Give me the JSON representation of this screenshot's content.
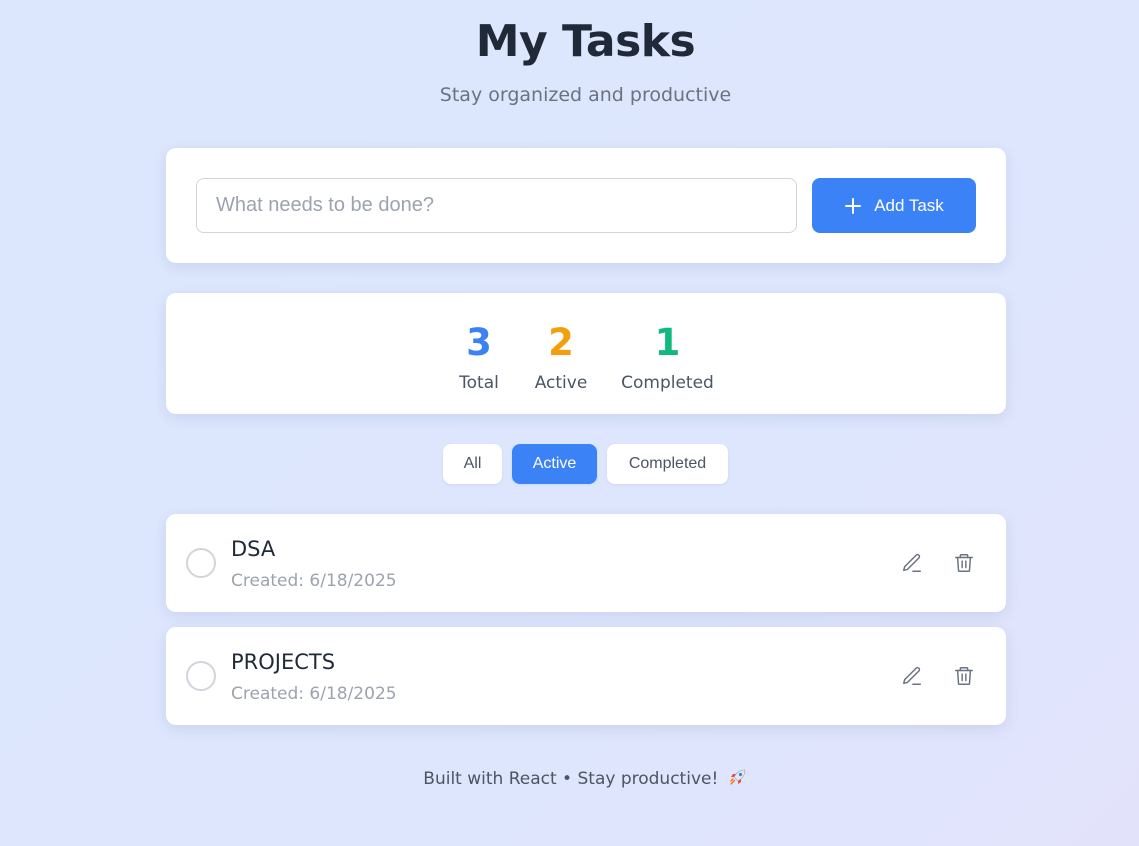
{
  "header": {
    "title": "My Tasks",
    "subtitle": "Stay organized and productive"
  },
  "input": {
    "placeholder": "What needs to be done?",
    "value": "",
    "add_label": "Add Task",
    "add_icon": "plus-icon"
  },
  "stats": {
    "total": {
      "value": "3",
      "label": "Total",
      "color": "#3b82f6"
    },
    "active": {
      "value": "2",
      "label": "Active",
      "color": "#f59e0b"
    },
    "completed": {
      "value": "1",
      "label": "Completed",
      "color": "#10b981"
    }
  },
  "filters": [
    {
      "label": "All",
      "selected": false
    },
    {
      "label": "Active",
      "selected": true
    },
    {
      "label": "Completed",
      "selected": false
    }
  ],
  "tasks": [
    {
      "text": "DSA",
      "created": "Created: 6/18/2025",
      "done": false
    },
    {
      "text": "PROJECTS",
      "created": "Created: 6/18/2025",
      "done": false
    }
  ],
  "footer": {
    "text": "Built with React • Stay productive!",
    "icon": "rocket-icon"
  },
  "colors": {
    "accent": "#3b82f6",
    "background": "#dce7fd"
  }
}
